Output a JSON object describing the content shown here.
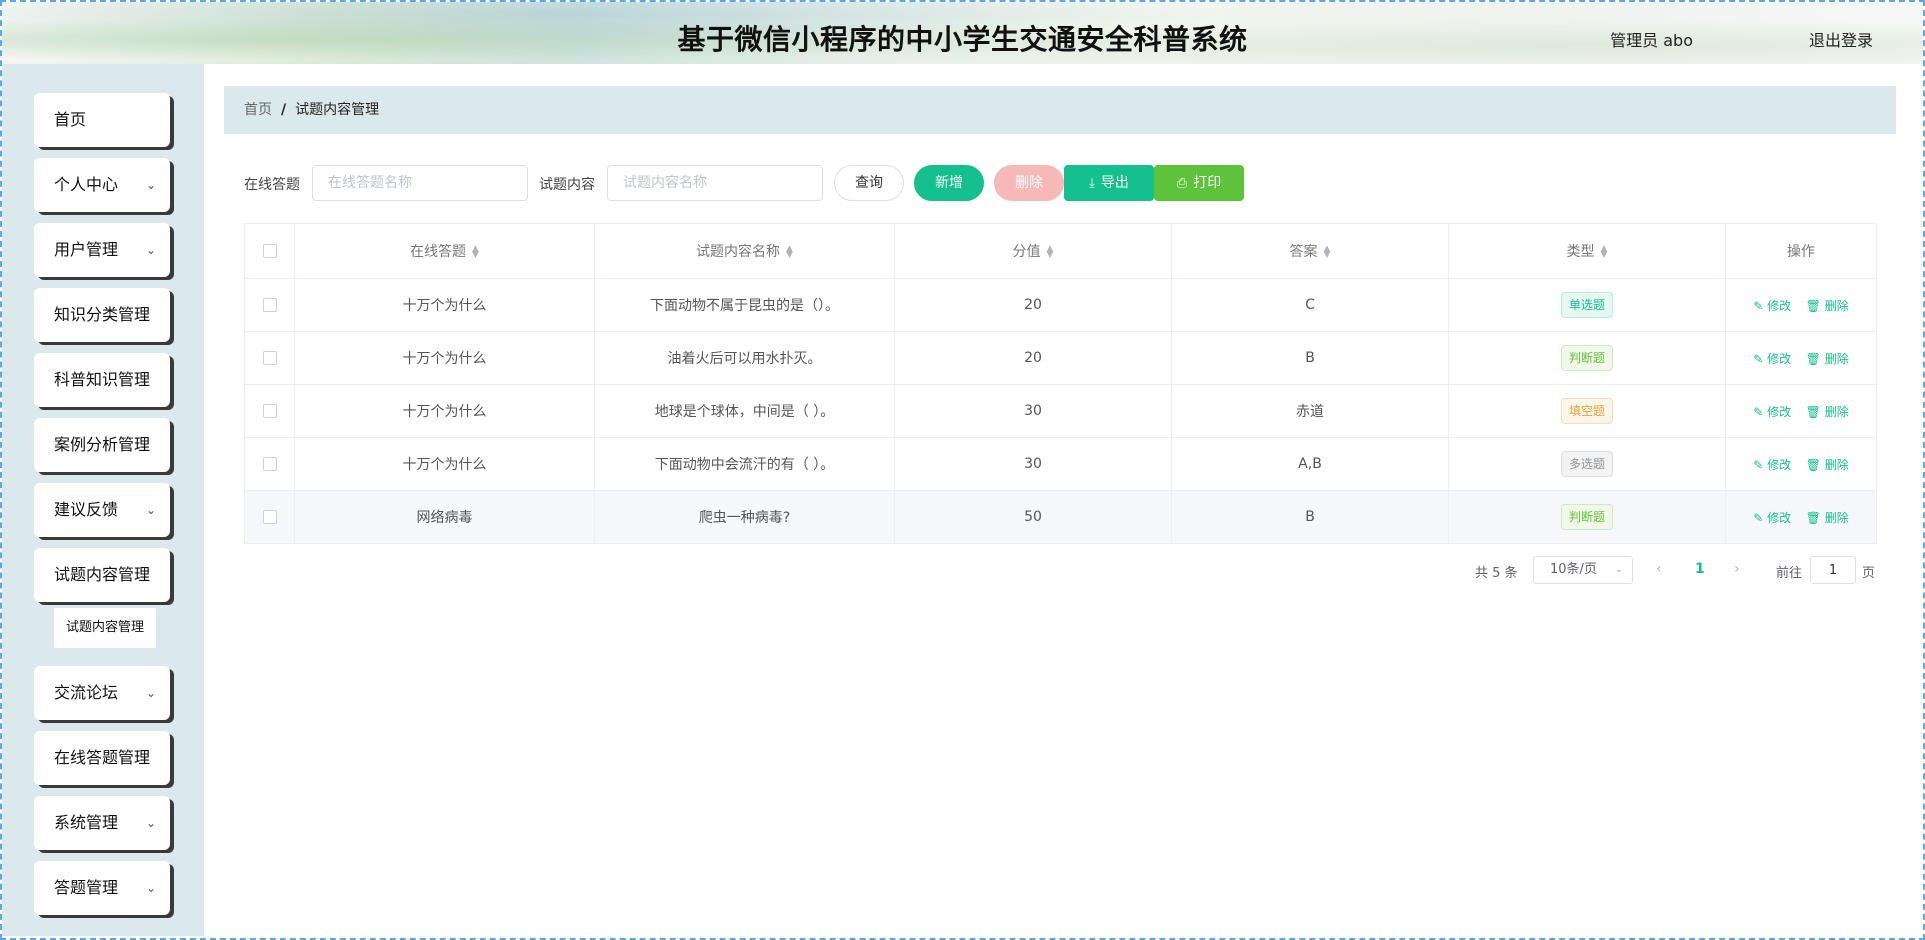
{
  "header": {
    "title": "基于微信小程序的中小学生交通安全科普系统",
    "user": "管理员 abo",
    "logout": "退出登录"
  },
  "sidebar": {
    "items": [
      {
        "label": "首页",
        "has_sub": false
      },
      {
        "label": "个人中心",
        "has_sub": true
      },
      {
        "label": "用户管理",
        "has_sub": true
      },
      {
        "label": "知识分类管理",
        "has_sub": false
      },
      {
        "label": "科普知识管理",
        "has_sub": false
      },
      {
        "label": "案例分析管理",
        "has_sub": false
      },
      {
        "label": "建议反馈",
        "has_sub": true
      },
      {
        "label": "试题内容管理",
        "has_sub": false
      },
      {
        "label": "交流论坛",
        "has_sub": true
      },
      {
        "label": "在线答题管理",
        "has_sub": false
      },
      {
        "label": "系统管理",
        "has_sub": true
      },
      {
        "label": "答题管理",
        "has_sub": true
      }
    ],
    "submenu": {
      "label": "试题内容管理"
    }
  },
  "breadcrumb": {
    "home": "首页",
    "sep": "/",
    "current": "试题内容管理"
  },
  "search": {
    "label1": "在线答题",
    "placeholder1": "在线答题名称",
    "label2": "试题内容",
    "placeholder2": "试题内容名称",
    "query": "查询",
    "add": "新增",
    "delete": "删除",
    "export": "导出",
    "print": "打印"
  },
  "table": {
    "headers": [
      "在线答题",
      "试题内容名称",
      "分值",
      "答案",
      "类型",
      "操作"
    ],
    "rows": [
      {
        "quiz": "十万个为什么",
        "content": "下面动物不属于昆虫的是（）。",
        "score": "20",
        "answer": "C",
        "type": "单选题",
        "type_class": "single"
      },
      {
        "quiz": "十万个为什么",
        "content": "油着火后可以用水扑灭。",
        "score": "20",
        "answer": "B",
        "type": "判断题",
        "type_class": "judge"
      },
      {
        "quiz": "十万个为什么",
        "content": "地球是个球体，中间是（ ）。",
        "score": "30",
        "answer": "赤道",
        "type": "填空题",
        "type_class": "fill"
      },
      {
        "quiz": "十万个为什么",
        "content": "下面动物中会流汗的有（ ）。",
        "score": "30",
        "answer": "A,B",
        "type": "多选题",
        "type_class": "multi"
      },
      {
        "quiz": "网络病毒",
        "content": "爬虫一种病毒?",
        "score": "50",
        "answer": "B",
        "type": "判断题",
        "type_class": "judge"
      }
    ],
    "op_edit": "修改",
    "op_delete": "删除"
  },
  "pagination": {
    "total": "共 5 条",
    "page_size": "10条/页",
    "current": "1",
    "goto_label": "前往",
    "goto_value": "1",
    "goto_unit": "页"
  },
  "colors": {
    "accent": "#13c08e",
    "print": "#5cc33b",
    "delete_disabled": "#f7b8b8",
    "panel": "#dbe9ec"
  }
}
